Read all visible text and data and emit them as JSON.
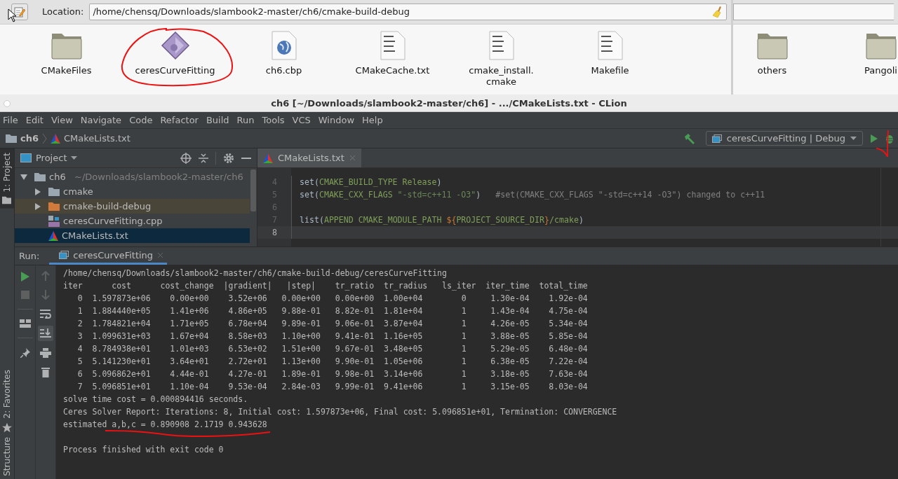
{
  "file_manager": {
    "location_label": "Location:",
    "location": "/home/chensq/Downloads/slambook2-master/ch6/cmake-build-debug",
    "items": [
      {
        "kind": "folder",
        "label": "CMakeFiles"
      },
      {
        "kind": "executable",
        "label": "ceresCurveFitting"
      },
      {
        "kind": "web",
        "label": "ch6.cbp"
      },
      {
        "kind": "text",
        "label": "CMakeCache.txt"
      },
      {
        "kind": "text",
        "label": "cmake_install.\ncmake"
      },
      {
        "kind": "text",
        "label": "Makefile"
      }
    ],
    "other_window_items": [
      {
        "kind": "folder",
        "label": "others"
      },
      {
        "kind": "folder",
        "label": "Pangoli"
      }
    ]
  },
  "window": {
    "title": "ch6 [~/Downloads/slambook2-master/ch6] - .../CMakeLists.txt - CLion"
  },
  "menu": [
    "File",
    "Edit",
    "View",
    "Navigate",
    "Code",
    "Refactor",
    "Build",
    "Run",
    "Tools",
    "VCS",
    "Window",
    "Help"
  ],
  "breadcrumbs": [
    {
      "kind": "folder",
      "label": "ch6"
    },
    {
      "kind": "cmake",
      "label": "CMakeLists.txt"
    }
  ],
  "run_config": "ceresCurveFitting | Debug",
  "tool_stripe": {
    "top": [
      {
        "kind": "project",
        "label": "1: Project",
        "selected": true
      }
    ],
    "bottom": [
      {
        "kind": "favorites",
        "label": "2: Favorites",
        "selected": false
      },
      {
        "kind": "structure",
        "label": "Structure",
        "selected": false
      }
    ]
  },
  "project_panel": {
    "title": "Project",
    "tree": [
      {
        "kind": "folder",
        "label": "ch6",
        "note": "~/Downloads/slambook2-master/ch6",
        "expanded": true,
        "selected": false,
        "children": [
          {
            "kind": "folder",
            "label": "cmake",
            "expanded": false,
            "selected": false
          },
          {
            "kind": "excluded",
            "label": "cmake-build-debug",
            "expanded": false,
            "selected": false
          },
          {
            "kind": "cpp",
            "label": "ceresCurveFitting.cpp",
            "selected": false
          },
          {
            "kind": "cmake",
            "label": "CMakeLists.txt",
            "selected": true
          }
        ]
      }
    ]
  },
  "editor": {
    "tabs": [
      {
        "label": "CMakeLists.txt",
        "selected": true
      }
    ],
    "lines": [
      {
        "number": "4",
        "current": false,
        "segments": [
          {
            "kind": "plain",
            "text": "set("
          },
          {
            "kind": "arg",
            "text": "CMAKE_BUILD_TYPE Release"
          },
          {
            "kind": "plain",
            "text": ")"
          }
        ]
      },
      {
        "number": "5",
        "current": false,
        "segments": [
          {
            "kind": "plain",
            "text": "set("
          },
          {
            "kind": "arg",
            "text": "CMAKE_CXX_FLAGS "
          },
          {
            "kind": "string",
            "text": "\"-std=c++11 -O3\""
          },
          {
            "kind": "plain",
            "text": ")   "
          },
          {
            "kind": "comment",
            "text": "#set(CMAKE_CXX_FLAGS \"-std=c++14 -O3\") changed to c++11"
          }
        ]
      },
      {
        "number": "6",
        "current": false
      },
      {
        "number": "7",
        "current": false,
        "segments": [
          {
            "kind": "plain",
            "text": "list("
          },
          {
            "kind": "arg",
            "text": "APPEND CMAKE_MODULE_PATH "
          },
          {
            "kind": "var",
            "text": "${"
          },
          {
            "kind": "arg",
            "text": "PROJECT_SOURCE_DIR"
          },
          {
            "kind": "var",
            "text": "}"
          },
          {
            "kind": "arg",
            "text": "/cmake"
          },
          {
            "kind": "plain",
            "text": ")"
          }
        ]
      },
      {
        "number": "8",
        "current": true
      }
    ]
  },
  "run_panel": {
    "label": "Run:",
    "tabs": [
      {
        "label": "ceresCurveFitting",
        "selected": true
      }
    ],
    "scroll_to_end": true,
    "output": [
      {
        "kind": "plain",
        "text": "/home/chensq/Downloads/slambook2-master/ch6/cmake-build-debug/ceresCurveFitting"
      },
      {
        "kind": "plain",
        "text": "iter      cost      cost_change  |gradient|   |step|    tr_ratio  tr_radius   ls_iter  iter_time  total_time"
      },
      {
        "kind": "plain",
        "text": "   0  1.597873e+06    0.00e+00    3.52e+06   0.00e+00   0.00e+00  1.00e+04        0     1.30e-04    1.92e-04"
      },
      {
        "kind": "plain",
        "text": "   1  1.884440e+05    1.41e+06    4.86e+05   9.88e-01   8.82e-01  1.81e+04        1     1.43e-04    4.75e-04"
      },
      {
        "kind": "plain",
        "text": "   2  1.784821e+04    1.71e+05    6.78e+04   9.89e-01   9.06e-01  3.87e+04        1     4.26e-05    5.34e-04"
      },
      {
        "kind": "plain",
        "text": "   3  1.099631e+03    1.67e+04    8.58e+03   1.10e+00   9.41e-01  1.16e+05        1     3.88e-05    5.85e-04"
      },
      {
        "kind": "plain",
        "text": "   4  8.784938e+01    1.01e+03    6.53e+02   1.51e+00   9.67e-01  3.48e+05        1     5.29e-05    6.48e-04"
      },
      {
        "kind": "plain",
        "text": "   5  5.141230e+01    3.64e+01    2.72e+01   1.13e+00   9.90e-01  1.05e+06        1     6.38e-05    7.22e-04"
      },
      {
        "kind": "plain",
        "text": "   6  5.096862e+01    4.44e-01    4.27e-01   1.89e-01   9.98e-01  3.14e+06        1     3.18e-05    7.63e-04"
      },
      {
        "kind": "plain",
        "text": "   7  5.096851e+01    1.10e-04    9.53e-04   2.84e-03   9.99e-01  9.41e+06        1     3.15e-05    8.03e-04"
      },
      {
        "kind": "plain",
        "text": "solve time cost = 0.000894416 seconds."
      },
      {
        "kind": "plain",
        "text": "Ceres Solver Report: Iterations: 8, Initial cost: 1.597873e+06, Final cost: 5.096851e+01, Termination: CONVERGENCE"
      },
      {
        "kind": "plain",
        "text": "estimated a,b,c = 0.890908 2.1719 0.943628"
      },
      {
        "kind": "exit",
        "text": "Process finished with exit code 0"
      }
    ]
  }
}
